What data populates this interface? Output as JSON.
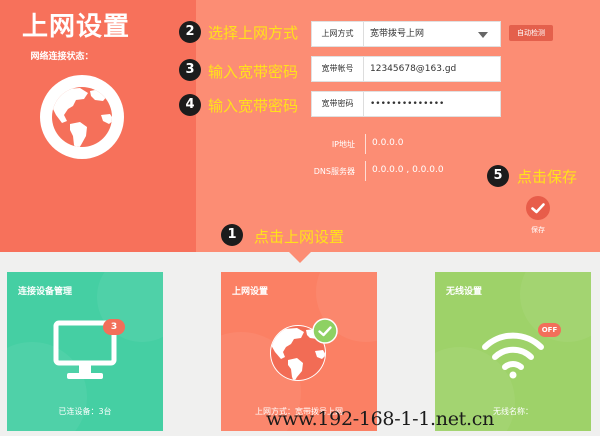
{
  "header": {
    "title": "上网设置",
    "status_label": "网络连接状态："
  },
  "steps": [
    {
      "number": "2",
      "text": "选择上网方式"
    },
    {
      "number": "3",
      "text": "输入宽带账号"
    },
    {
      "number": "4",
      "text": "输入宽带密码"
    },
    {
      "number": "5",
      "text": "点击保存"
    },
    {
      "number": "1",
      "text": "点击上网设置"
    }
  ],
  "form": {
    "mode": {
      "label": "上网方式",
      "value": "宽带拨号上网"
    },
    "account": {
      "label": "宽带帐号",
      "value": "12345678@163.gd"
    },
    "password": {
      "label": "宽带密码",
      "value": "••••••••••••••"
    },
    "auto_detect_label": "自动检测"
  },
  "info": {
    "ip": {
      "label": "IP地址",
      "value": "0.0.0.0"
    },
    "dns": {
      "label": "DNS服务器",
      "value": "0.0.0.0 , 0.0.0.0"
    }
  },
  "save": {
    "label": "保存",
    "icon": "check-icon"
  },
  "cards": {
    "devices": {
      "title": "连接设备管理",
      "badge": "3",
      "footer": "已连设备：3台",
      "icon": "monitor-icon",
      "color": "#45cfa3"
    },
    "internet": {
      "title": "上网设置",
      "footer": "上网方式：宽带拨号上网",
      "icon": "globe-icon",
      "color": "#fb8064"
    },
    "wireless": {
      "title": "无线设置",
      "badge": "OFF",
      "footer": "无线名称：",
      "icon": "wifi-icon",
      "color": "#9ed269"
    }
  },
  "watermark": "www.192-168-1-1.net.cn",
  "colors": {
    "panel": "#fc8d74",
    "panel_dark": "#f7715b",
    "step_text": "#ffe21a",
    "accent": "#e4604c",
    "background": "#f0f0ef"
  }
}
